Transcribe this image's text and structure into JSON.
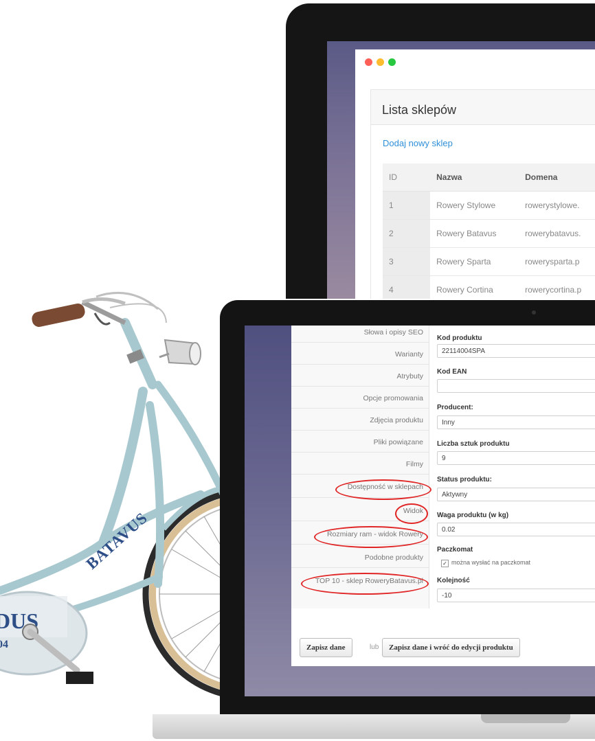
{
  "back_window": {
    "title": "Lista sklepów",
    "add_link": "Dodaj nowy sklep",
    "columns": [
      "ID",
      "Nazwa",
      "Domena"
    ],
    "rows": [
      {
        "id": "1",
        "name": "Rowery Stylowe",
        "domain": "rowerystylowe."
      },
      {
        "id": "2",
        "name": "Rowery Batavus",
        "domain": "rowerybatavus."
      },
      {
        "id": "3",
        "name": "Rowery Sparta",
        "domain": "rowerysparta.p"
      },
      {
        "id": "4",
        "name": "Rowery Cortina",
        "domain": "rowerycortina.p"
      }
    ]
  },
  "product_form": {
    "sidebar": [
      "Słowa i opisy SEO",
      "Warianty",
      "Atrybuty",
      "Opcje promowania",
      "Zdjęcia produktu",
      "Pliki powiązane",
      "Filmy",
      "Dostępność w sklepach",
      "Widok",
      "Rozmiary ram - widok Rowery",
      "Podobne produkty",
      "TOP 10 - sklep RoweryBatavus.pl"
    ],
    "fields": {
      "product_code": {
        "label": "Kod produktu",
        "value": "22114004SPA"
      },
      "ean": {
        "label": "Kod EAN",
        "value": ""
      },
      "producer": {
        "label": "Producent:",
        "value": "Inny"
      },
      "stock_count": {
        "label": "Liczba sztuk produktu",
        "value": "9"
      },
      "status": {
        "label": "Status produktu:",
        "value": "Aktywny"
      },
      "weight": {
        "label": "Waga produktu (w kg)",
        "value": "0.02"
      },
      "parcel_locker": {
        "label": "Paczkomat",
        "checkbox_label": "można wysłać na paczkomat",
        "checked": true
      },
      "order": {
        "label": "Kolejność",
        "value": "-10"
      }
    },
    "buttons": {
      "save": "Zapisz dane",
      "or": "lub",
      "save_and_return": "Zapisz dane i wróć do edycji produktu"
    }
  },
  "bike": {
    "brand": "BATAVUS",
    "chainguard_text": "DUS",
    "chainguard_subtext": "04"
  },
  "colors": {
    "frame": "#a8c8cf",
    "highlight": "#e02626",
    "link": "#2f8fd8"
  }
}
